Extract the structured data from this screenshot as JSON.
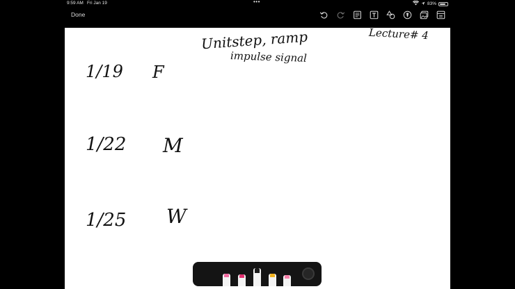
{
  "status_bar": {
    "time": "9:59 AM",
    "date": "Fri Jan 19",
    "dots": "•••",
    "battery": "83%",
    "battery_level": 0.83
  },
  "toolbar": {
    "done_label": "Done",
    "tools": [
      {
        "name": "undo-icon",
        "enabled": true
      },
      {
        "name": "redo-icon",
        "enabled": false
      },
      {
        "name": "scan-document-icon",
        "enabled": true
      },
      {
        "name": "text-box-icon",
        "enabled": true
      },
      {
        "name": "shapes-icon",
        "enabled": true
      },
      {
        "name": "pen-tool-icon",
        "enabled": true
      },
      {
        "name": "photo-icon",
        "enabled": true
      },
      {
        "name": "page-icon",
        "enabled": true
      }
    ]
  },
  "note": {
    "title_line1": "Unitstep, ramp",
    "title_line2": "impulse signal",
    "lecture": "Lecture# 4",
    "rows": [
      {
        "date": "1/19",
        "letter": "F"
      },
      {
        "date": "1/22",
        "letter": "M"
      },
      {
        "date": "1/25",
        "letter": "W"
      }
    ]
  },
  "palette": {
    "pens": [
      {
        "name": "highlighter-pink",
        "tip_color": "#f06aa0"
      },
      {
        "name": "marker-pink",
        "tip_color": "#e0306f"
      },
      {
        "name": "pen-black",
        "tip_color": "#1a1a1a"
      },
      {
        "name": "pencil-yellow",
        "tip_color": "#f2b21d"
      },
      {
        "name": "eraser-pink",
        "tip_color": "#f57fa8"
      }
    ]
  }
}
